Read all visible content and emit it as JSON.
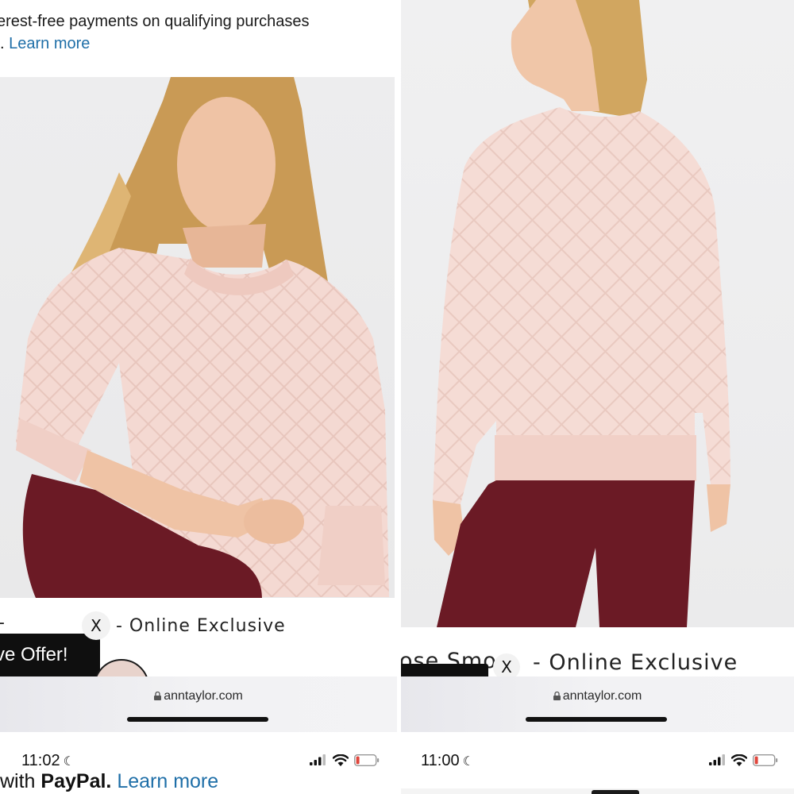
{
  "promo": {
    "line1": "erest-free payments on qualifying purchases",
    "line2_prefix": ".",
    "learn_more": "Learn more"
  },
  "left": {
    "title_fragment": "-",
    "title_suffix": "- Online Exclusive",
    "offer_label": "ve Offer!",
    "close_label": "X",
    "url": "anntaylor.com",
    "time": "11:02",
    "bottom_cut_prefix": "with ",
    "bottom_cut_bold": "PayPal.",
    "bottom_cut_link": "Learn more"
  },
  "right": {
    "title_fragment": "ose Smo",
    "title_suffix": "- Online Exclusive",
    "close_label": "X",
    "url": "anntaylor.com",
    "time": "11:00"
  },
  "colors": {
    "link": "#1f6fa8",
    "sweater": "#f3d6cf",
    "pants": "#6b1a25",
    "battery_low": "#e0463c"
  },
  "icons": [
    "lock-icon",
    "moon-icon",
    "signal-icon",
    "wifi-icon",
    "battery-icon",
    "close-icon"
  ]
}
